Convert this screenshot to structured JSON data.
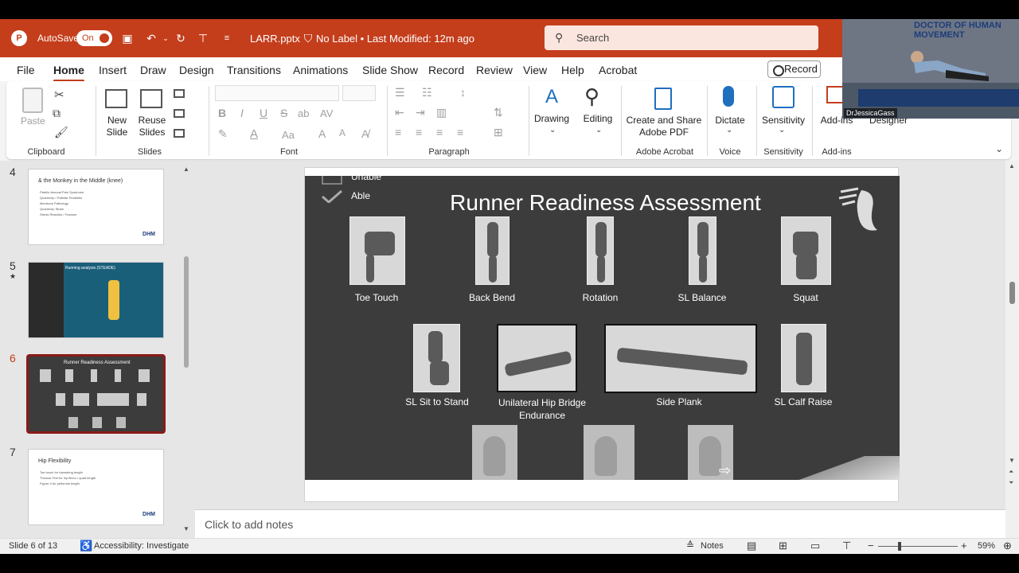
{
  "titlebar": {
    "autosave_label": "AutoSave",
    "autosave_state": "On",
    "file_name": "LARR.pptx",
    "label_status": "No Label • Last Modified: 12m ago",
    "search_placeholder": "Search"
  },
  "menu": {
    "items": [
      "File",
      "Home",
      "Insert",
      "Draw",
      "Design",
      "Transitions",
      "Animations",
      "Slide Show",
      "Record",
      "Review",
      "View",
      "Help",
      "Acrobat"
    ],
    "active": "Home",
    "record_button": "Record"
  },
  "ribbon": {
    "clipboard": {
      "paste": "Paste",
      "group": "Clipboard"
    },
    "slides": {
      "new_slide": "New\nSlide",
      "reuse_slides": "Reuse\nSlides",
      "group": "Slides"
    },
    "font": {
      "group": "Font",
      "bold": "B",
      "italic": "I",
      "underline": "U",
      "strike": "S",
      "size_up": "A^",
      "size_down": "Aˇ",
      "case": "Aa"
    },
    "paragraph": {
      "group": "Paragraph"
    },
    "drawing": {
      "label": "Drawing"
    },
    "editing": {
      "label": "Editing"
    },
    "adobe": {
      "label": "Create and Share Adobe PDF",
      "group": "Adobe Acrobat"
    },
    "voice": {
      "label": "Dictate",
      "group": "Voice"
    },
    "sensitivity": {
      "label": "Sensitivity",
      "group": "Sensitivity"
    },
    "addins": {
      "label": "Add-ins",
      "group": "Add-ins"
    },
    "designer": {
      "label": "Designer"
    }
  },
  "webcam": {
    "name_tag": "DrJessicaGass",
    "brand": "DOCTOR OF HUMAN MOVEMENT"
  },
  "thumbnails": [
    {
      "num": "4",
      "title": "& the Monkey in the Middle (knee)",
      "lines": [
        "Patello-femoral Pain Syndrome",
        "Quadricep / Patellar Tendinitis",
        "Meniscus Pathology",
        "Quadricep Strain",
        "Stress Reaction / Fracture"
      ],
      "logo": "DHM"
    },
    {
      "num": "5",
      "title": "Running analysis (STEADE)",
      "star": "★"
    },
    {
      "num": "6",
      "title": "Runner Readiness Assessment"
    },
    {
      "num": "7",
      "title": "Hip Flexibility",
      "lines": [
        "Toe touch for hamstring length",
        "Thomas Test for hip flexor / quad length",
        "Figure 4 for piriformis length"
      ],
      "logo": "DHM"
    }
  ],
  "slide": {
    "title": "Runner Readiness Assessment",
    "legend_unable": "Unable",
    "legend_able": "Able",
    "row1": [
      "Toe Touch",
      "Back Bend",
      "Rotation",
      "SL Balance",
      "Squat"
    ],
    "row2": [
      "SL Sit to Stand",
      "Unilateral Hip Bridge Endurance",
      "Side Plank",
      "SL Calf Raise"
    ]
  },
  "notes_placeholder": "Click to add notes",
  "status": {
    "slide_counter": "Slide 6 of 13",
    "accessibility": "Accessibility: Investigate",
    "notes": "Notes",
    "zoom": "59%"
  }
}
